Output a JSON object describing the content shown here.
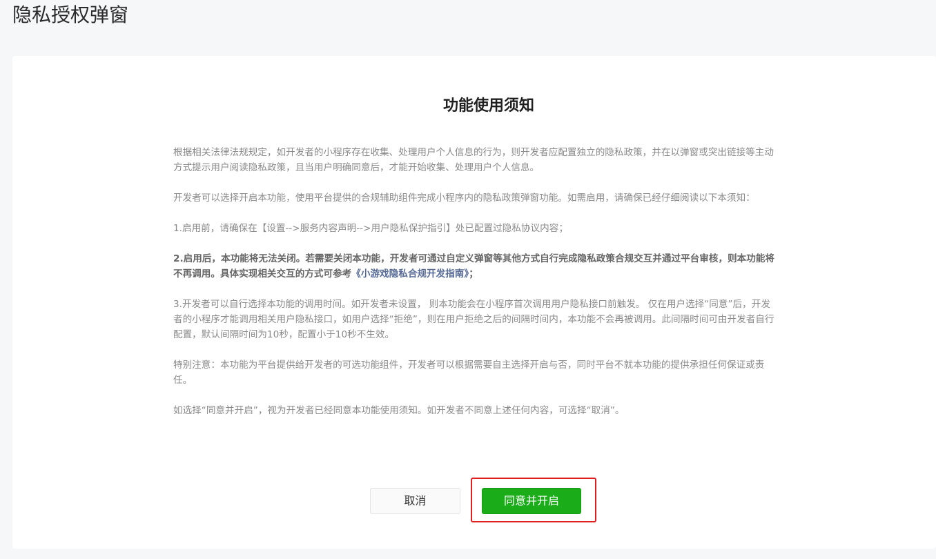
{
  "header": {
    "title": "隐私授权弹窗"
  },
  "notice": {
    "title": "功能使用须知",
    "para1": "根据相关法律法规规定，如开发者的小程序存在收集、处理用户个人信息的行为，则开发者应配置独立的隐私政策，并在以弹窗或突出链接等主动方式提示用户阅读隐私政策，且当用户明确同意后，才能开始收集、处理用户个人信息。",
    "para2": "开发者可以选择开启本功能，使用平台提供的合规辅助组件完成小程序内的隐私政策弹窗功能。如需启用，请确保已经仔细阅读以下本须知：",
    "item1": "1.启用前，请确保在【设置-->服务内容声明-->用户隐私保护指引】处已配置过隐私协议内容；",
    "item2_text": "2.启用后，本功能将无法关闭。若需要关闭本功能，开发者可通过自定义弹窗等其他方式自行完成隐私政策合规交互并通过平台审核，则本功能将不再调用。具体实现相关交互的方式可参考",
    "item2_link": "《小游戏隐私合规开发指南》",
    "item2_end": "；",
    "item3": "3.开发者可以自行选择本功能的调用时间。如开发者未设置， 则本功能会在小程序首次调用用户隐私接口前触发。 仅在用户选择“同意”后，开发者的小程序才能调用相关用户隐私接口，如用户选择“拒绝”，则在用户拒绝之后的间隔时间内，本功能不会再被调用。此间隔时间可由开发者自行配置，默认间隔时间为10秒，配置小于10秒不生效。",
    "para_special": "特别注意：本功能为平台提供给开发者的可选功能组件，开发者可以根据需要自主选择开启与否，同时平台不就本功能的提供承担任何保证或责任。",
    "para_final": "如选择“同意并开启”，视为开发者已经同意本功能使用须知。如开发者不同意上述任何内容，可选择“取消”。"
  },
  "buttons": {
    "cancel_label": "取消",
    "agree_label": "同意并开启"
  },
  "colors": {
    "accent_green": "#1aad19",
    "link_blue": "#576b95",
    "highlight_red": "#e02020"
  }
}
